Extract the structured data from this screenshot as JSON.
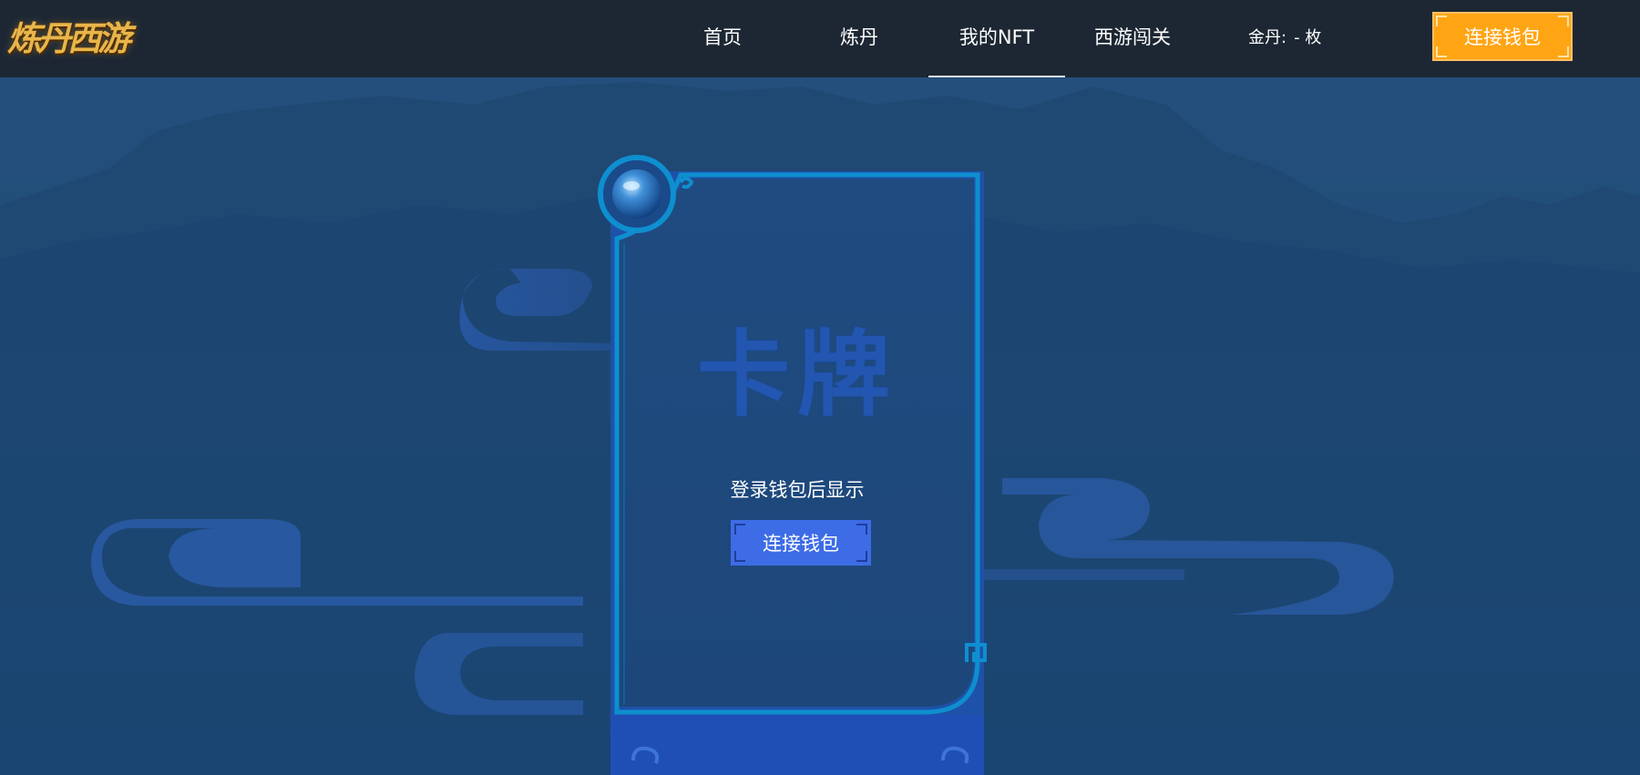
{
  "logo": {
    "text": "炼丹西游"
  },
  "nav": {
    "items": [
      {
        "label": "首页",
        "active": false
      },
      {
        "label": "炼丹",
        "active": false
      },
      {
        "label": "我的NFT",
        "active": true
      },
      {
        "label": "西游闯关",
        "active": false
      }
    ],
    "balance": {
      "label": "金丹:",
      "value": "-",
      "unit": "枚"
    },
    "connect_button": "连接钱包"
  },
  "card": {
    "title": "卡牌",
    "hint": "登录钱包后显示",
    "connect_button": "连接钱包"
  },
  "colors": {
    "nav_bg": "#1d2733",
    "page_bg": "#1d4a78",
    "accent_orange": "#ffa514",
    "accent_blue": "#3d6ce6",
    "card_frame": "#0e8fd0"
  }
}
